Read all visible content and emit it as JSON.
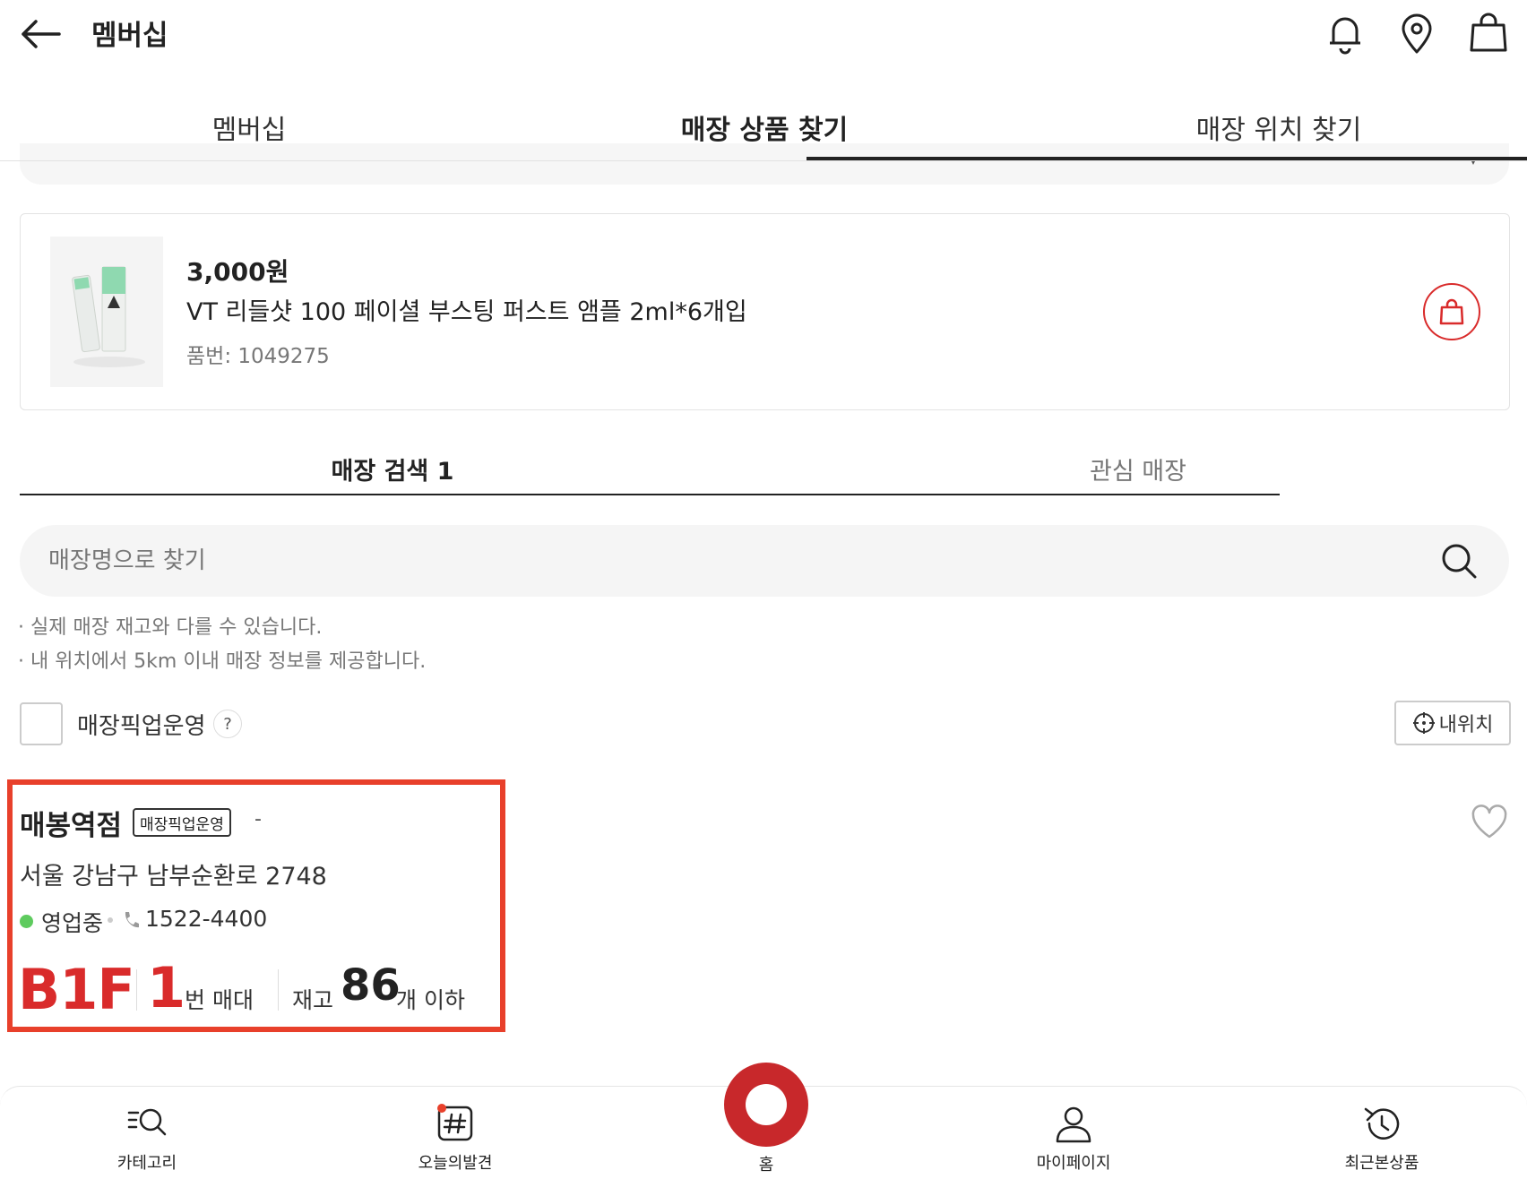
{
  "header": {
    "title": "멤버십",
    "icons": [
      "back-arrow-icon",
      "bell-icon",
      "location-pin-icon",
      "shopping-bag-icon"
    ]
  },
  "main_tabs": [
    {
      "label": "멤버십",
      "active": false
    },
    {
      "label": "매장 상품 찾기",
      "active": true
    },
    {
      "label": "매장 위치 찾기",
      "active": false
    }
  ],
  "product": {
    "price": "3,000원",
    "name": "VT 리들샷 100 페이셜 부스팅 퍼스트 앰플 2ml*6개입",
    "code": "품번: 1049275"
  },
  "store_tabs": [
    {
      "label": "매장 검색 1",
      "active": true
    },
    {
      "label": "관심 매장",
      "active": false
    }
  ],
  "search": {
    "placeholder": "매장명으로 찾기",
    "value": ""
  },
  "notes": [
    "실제 매장 재고와 다를 수 있습니다.",
    "내 위치에서 5km 이내 매장 정보를 제공합니다."
  ],
  "filter": {
    "pickup_label": "매장픽업운영",
    "help": "?",
    "my_location": "내위치"
  },
  "store": {
    "name": "매봉역점",
    "badge": "매장픽업운영",
    "dash": "-",
    "address": "서울 강남구 남부순환로 2748",
    "status": "영업중",
    "phone": "1522-4400",
    "floor": "B1F",
    "shelf_number": "1",
    "shelf_unit": "번 매대",
    "stock_label": "재고",
    "stock_number": "86",
    "stock_unit": "개 이하"
  },
  "colors": {
    "accent_red": "#d92b2b",
    "highlight": "#e8402b",
    "open_green": "#5ecb5e"
  },
  "bottom_nav": [
    {
      "label": "카테고리",
      "icon": "category-search-icon"
    },
    {
      "label": "오늘의발견",
      "icon": "hashtag-icon"
    },
    {
      "label": "홈",
      "icon": "home-logo-icon"
    },
    {
      "label": "마이페이지",
      "icon": "user-icon"
    },
    {
      "label": "최근본상품",
      "icon": "history-icon"
    }
  ]
}
